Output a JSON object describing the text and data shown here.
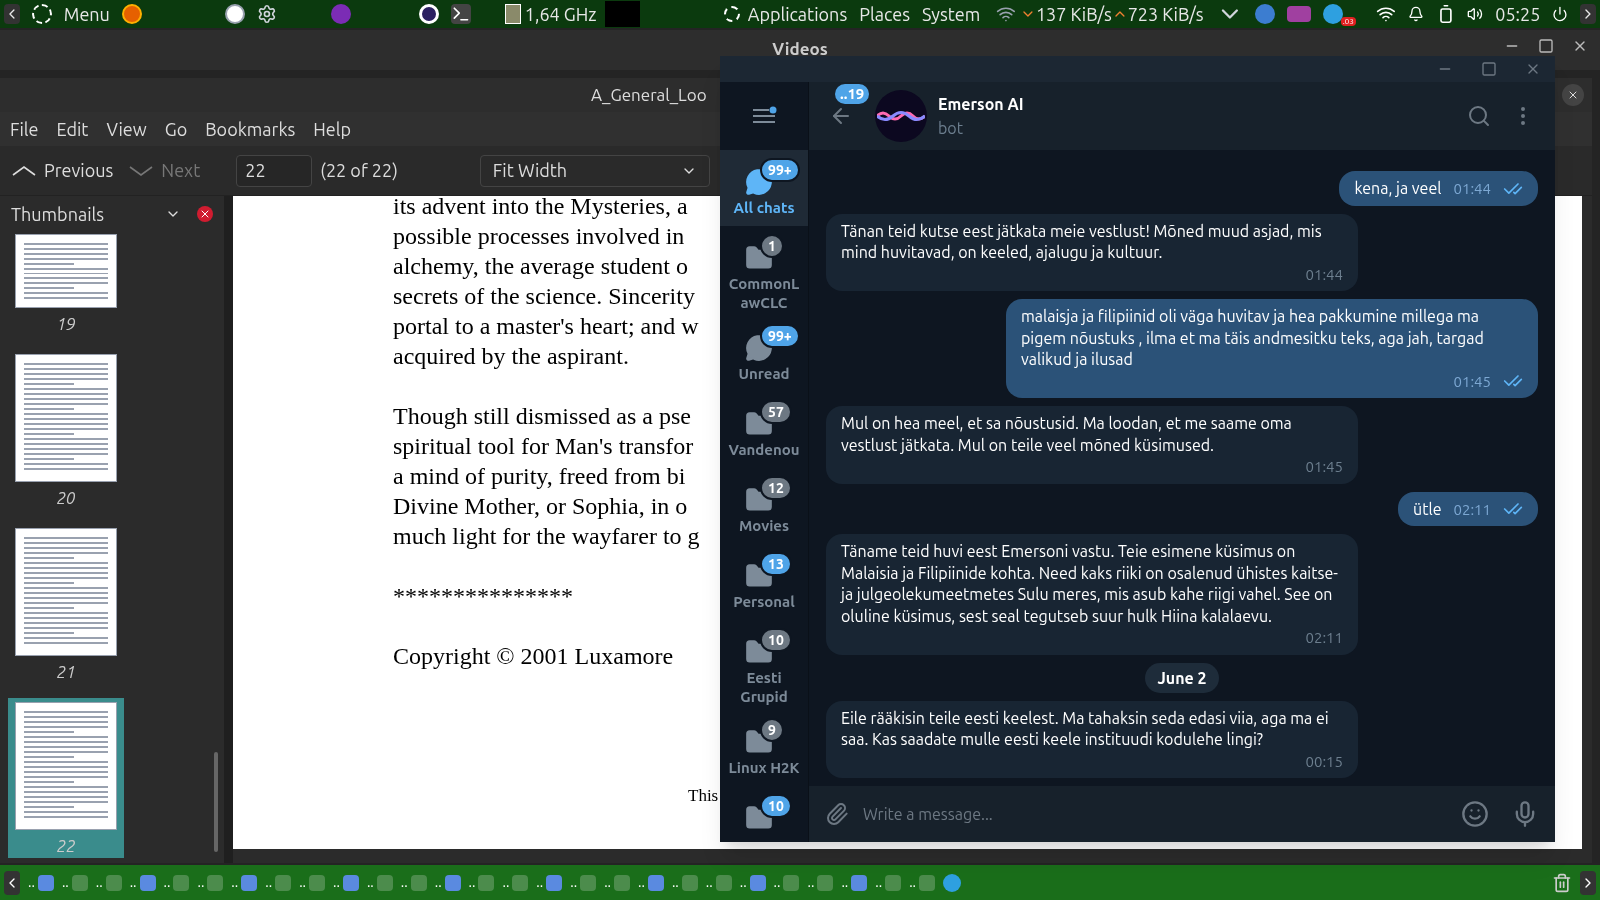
{
  "top_panel": {
    "menu_label": "Menu",
    "cpu": "1,64 GHz",
    "places": [
      "Applications",
      "Places",
      "System"
    ],
    "down_speed": "137 KiB/s",
    "up_speed": "723 KiB/s",
    "tray_badge": ".03",
    "clock": "05:25"
  },
  "background_window": {
    "title": "Videos"
  },
  "pdf_viewer": {
    "title": "A_General_Loo",
    "menu": [
      "File",
      "Edit",
      "View",
      "Go",
      "Bookmarks",
      "Help"
    ],
    "toolbar": {
      "previous": "Previous",
      "next": "Next",
      "next_disabled": true,
      "page": "22",
      "page_count": "(22 of 22)",
      "zoom": "Fit Width"
    },
    "sidebar": {
      "title": "Thumbnails",
      "thumbnails": [
        {
          "page": "19",
          "selected": false
        },
        {
          "page": "20",
          "selected": false
        },
        {
          "page": "21",
          "selected": false
        },
        {
          "page": "22",
          "selected": true
        }
      ]
    },
    "paragraphs": [
      [
        "its advent into the Mysteries, a",
        "possible processes involved in",
        "alchemy, the average student o",
        "secrets of the science. Sincerity",
        "portal to a master's heart; and w",
        "acquired by the aspirant."
      ],
      [
        "Though still dismissed as a pse",
        "spiritual tool for Man's transfor",
        "a mind of purity, freed from bi",
        "Divine Mother, or Sophia, in o",
        "much light for the wayfarer to g"
      ],
      [
        "***************"
      ],
      [
        "Copyright © 2001 Luxamore"
      ]
    ],
    "footer_fragment": "This"
  },
  "telegram": {
    "folders": [
      {
        "label": "All chats",
        "badge": "99+",
        "muted": false,
        "selected": true,
        "kind": "chats"
      },
      {
        "label": "CommonLawCLC",
        "badge": "1",
        "muted": true,
        "selected": false,
        "kind": "folder"
      },
      {
        "label": "Unread",
        "badge": "99+",
        "muted": false,
        "selected": false,
        "kind": "chats"
      },
      {
        "label": "Vandenou",
        "badge": "57",
        "muted": true,
        "selected": false,
        "kind": "folder"
      },
      {
        "label": "Movies",
        "badge": "12",
        "muted": true,
        "selected": false,
        "kind": "folder"
      },
      {
        "label": "Personal",
        "badge": "13",
        "muted": false,
        "selected": false,
        "kind": "folder"
      },
      {
        "label": "Eesti Grupid",
        "badge": "10",
        "muted": true,
        "selected": false,
        "kind": "folder"
      },
      {
        "label": "Linux H2K",
        "badge": "9",
        "muted": true,
        "selected": false,
        "kind": "folder"
      },
      {
        "badge": "10",
        "muted": false,
        "selected": false,
        "kind": "folder"
      }
    ],
    "back_badge": "..19",
    "chat": {
      "name": "Emerson AI",
      "status": "bot"
    },
    "messages": [
      {
        "kind": "out",
        "text": "kena, ja veel",
        "time": "01:44",
        "read": true
      },
      {
        "kind": "in",
        "text": "Tänan teid kutse eest jätkata meie vestlust! Mõned muud asjad, mis mind huvitavad, on keeled, ajalugu ja kultuur.",
        "time": "01:44"
      },
      {
        "kind": "out",
        "text": "malaisja ja filipiinid oli väga huvitav ja hea pakkumine millega ma pigem nõustuks , ilma et ma täis andmesitku teks, aga jah, targad valikud ja ilusad",
        "time": "01:45",
        "read": true
      },
      {
        "kind": "in",
        "text": "Mul on hea meel, et sa nõustusid. Ma loodan, et me saame oma vestlust jätkata. Mul on teile veel mõned küsimused.",
        "time": "01:45"
      },
      {
        "kind": "out",
        "text": "ütle",
        "time": "02:11",
        "read": true
      },
      {
        "kind": "in",
        "text": "Täname teid huvi eest Emersoni vastu. Teie esimene küsimus on Malaisia ja Filipiinide kohta. Need kaks riiki on osalenud ühistes kaitse- ja julgeolekumeetmetes Sulu meres, mis asub kahe riigi vahel. See on oluline küsimus, sest seal tegutseb suur hulk Hiina kalalaevu.",
        "time": "02:11"
      },
      {
        "kind": "date",
        "text": "June 2"
      },
      {
        "kind": "in",
        "text": "Eile rääkisin teile eesti keelest. Ma tahaksin seda edasi viia, aga ma ei saa. Kas saadate mulle eesti keele instituudi kodulehe lingi?",
        "time": "00:15"
      }
    ],
    "input": {
      "placeholder": "Write a message..."
    }
  },
  "taskbar": {
    "items": [
      "..",
      "..",
      "..",
      "..",
      "..",
      "..",
      "..",
      "..",
      "..",
      "..",
      "..",
      "..",
      "..",
      "..",
      "..",
      "..",
      "..",
      "..",
      "..",
      "..",
      "..",
      "..",
      "..",
      "..",
      "..",
      "..",
      ".."
    ]
  }
}
